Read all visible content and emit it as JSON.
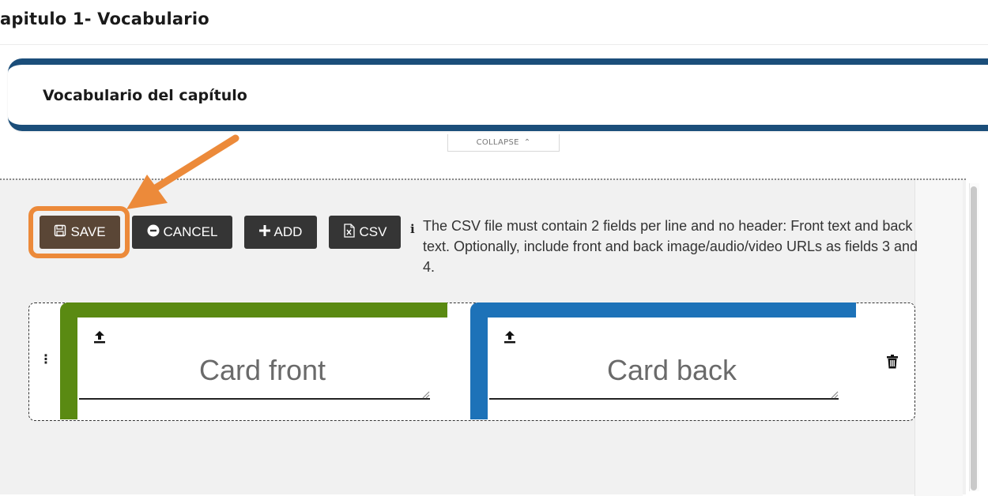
{
  "page": {
    "title": "apitulo 1- Vocabulario"
  },
  "section": {
    "title": "Vocabulario del capítulo",
    "collapse_label": "COLLAPSE",
    "collapse_icon": "double-chevron-up-icon"
  },
  "toolbar": {
    "save_label": "SAVE",
    "cancel_label": "CANCEL",
    "add_label": "ADD",
    "csv_label": "CSV",
    "info_text": "The CSV file must contain 2 fields per line and no header: Front text and back text. Optionally, include front and back image/audio/video URLs as fields 3 and 4."
  },
  "card": {
    "front_placeholder": "Card front",
    "back_placeholder": "Card back",
    "front_color": "#5a8a12",
    "back_color": "#1d72b8"
  },
  "colors": {
    "accent_blue": "#1b4e7a",
    "highlight": "#ec8a3a",
    "save_button": "#5a4636",
    "button_dark": "#353535"
  }
}
